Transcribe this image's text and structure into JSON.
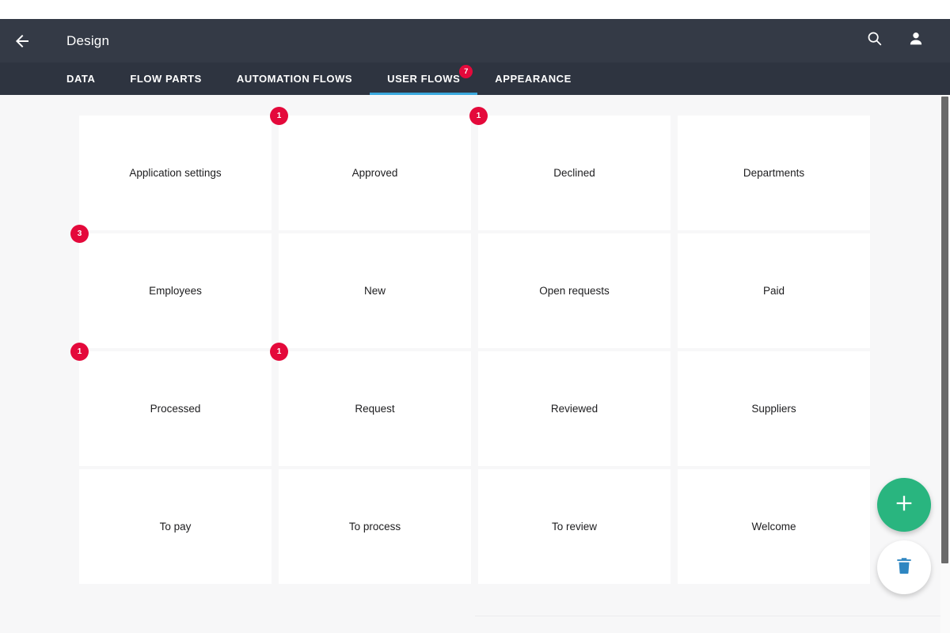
{
  "appbar": {
    "title": "Design",
    "back_icon": "arrow-left-icon",
    "search_icon": "search-icon",
    "account_icon": "person-icon"
  },
  "tabs": [
    {
      "label": "DATA",
      "active": false,
      "badge": null
    },
    {
      "label": "FLOW PARTS",
      "active": false,
      "badge": null
    },
    {
      "label": "AUTOMATION FLOWS",
      "active": false,
      "badge": null
    },
    {
      "label": "USER FLOWS",
      "active": true,
      "badge": "7"
    },
    {
      "label": "APPEARANCE",
      "active": false,
      "badge": null
    }
  ],
  "cards": [
    {
      "label": "Application settings",
      "badge": null
    },
    {
      "label": "Approved",
      "badge": "1"
    },
    {
      "label": "Declined",
      "badge": "1"
    },
    {
      "label": "Departments",
      "badge": null
    },
    {
      "label": "Employees",
      "badge": "3"
    },
    {
      "label": "New",
      "badge": null
    },
    {
      "label": "Open requests",
      "badge": null
    },
    {
      "label": "Paid",
      "badge": null
    },
    {
      "label": "Processed",
      "badge": "1"
    },
    {
      "label": "Request",
      "badge": "1"
    },
    {
      "label": "Reviewed",
      "badge": null
    },
    {
      "label": "Suppliers",
      "badge": null
    },
    {
      "label": "To pay",
      "badge": null
    },
    {
      "label": "To process",
      "badge": null
    },
    {
      "label": "To review",
      "badge": null
    },
    {
      "label": "Welcome",
      "badge": null
    }
  ],
  "floating_actions": {
    "add_icon": "plus-icon",
    "delete_icon": "trash-icon"
  },
  "colors": {
    "appbar": "#343a46",
    "tabbar": "#2e3440",
    "tab_active_underline": "#3aa8dd",
    "badge": "#e4093b",
    "fab_add": "#29b57f",
    "trash_icon": "#2e86c1",
    "content_bg": "#f7f7f8",
    "card_bg": "#ffffff"
  }
}
